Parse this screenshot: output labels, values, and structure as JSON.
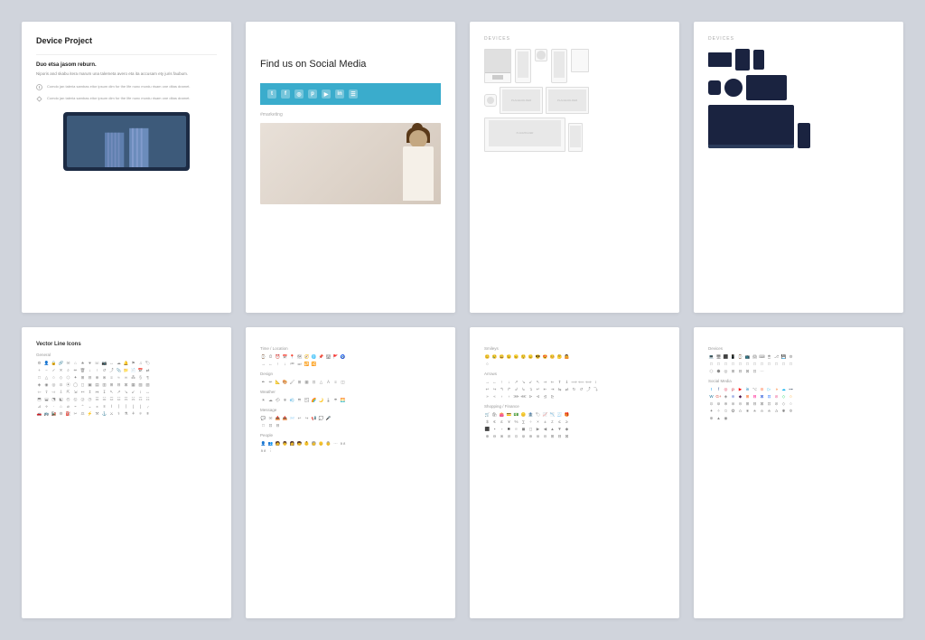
{
  "page": {
    "bg_color": "#d0d4dc"
  },
  "cards": [
    {
      "id": "card-1",
      "title": "Device Project",
      "subtitle": "Duo etsa jasom reburn.",
      "body_text": "Niporis and skabu itera marum una talemeta avero eta ita accusam ety juris faubum.",
      "list_items": [
        "Comdo jan taleria sambas eitor ipsum dim for the life nunc mordu risam one ditas dramet.",
        "Comdo jan taleria sambas eitor ipsum dim for the life nunc mordu risam one ditas dramet."
      ],
      "image_type": "tablet_building"
    },
    {
      "id": "card-2",
      "title": "Find us on Social Media",
      "social_icons": [
        "t",
        "f",
        "i",
        "p",
        "yt",
        "in",
        "li"
      ],
      "hashtag": "#marketing",
      "image_type": "person_photo"
    },
    {
      "id": "card-3",
      "label": "DEVICES",
      "image_type": "devices_white"
    },
    {
      "id": "card-4",
      "label": "DEVICES",
      "image_type": "devices_dark"
    },
    {
      "id": "card-5",
      "title": "Vector Line Icons",
      "categories": [
        {
          "name": "General",
          "icon_count": 80
        },
        {
          "name": "",
          "icon_count": 60
        },
        {
          "name": "",
          "icon_count": 60
        }
      ]
    },
    {
      "id": "card-6",
      "categories": [
        {
          "name": "Time / Location"
        },
        {
          "name": "Design"
        },
        {
          "name": "Weather"
        },
        {
          "name": "Message"
        },
        {
          "name": "People"
        }
      ]
    },
    {
      "id": "card-7",
      "categories": [
        {
          "name": "Smileys"
        },
        {
          "name": "Arrows"
        },
        {
          "name": "Shopping / Finance"
        }
      ]
    },
    {
      "id": "card-8",
      "categories": [
        {
          "name": "Devices"
        },
        {
          "name": "Social Media"
        }
      ]
    }
  ]
}
